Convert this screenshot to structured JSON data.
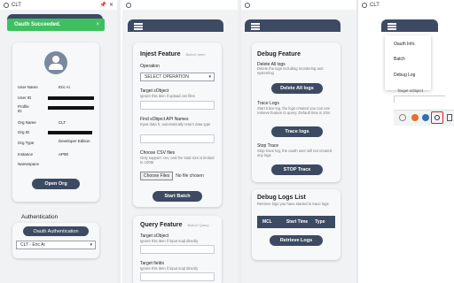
{
  "panel1": {
    "window_title": "CLT",
    "toast": {
      "text": "Oauth Succeeded.",
      "close": "×"
    },
    "profile": {
      "rows": [
        {
          "label": "User Name",
          "value": "Eric Ai"
        },
        {
          "label": "User ID",
          "value": ""
        },
        {
          "label": "Profile ID",
          "value": ""
        },
        {
          "label": "Org Name",
          "value": "CLT"
        },
        {
          "label": "Org ID",
          "value": ""
        },
        {
          "label": "Org Type",
          "value": "Developer Edition"
        },
        {
          "label": "Instance",
          "value": "AP90"
        },
        {
          "label": "Namespace",
          "value": ""
        }
      ],
      "open_org_label": "Open Org"
    },
    "auth": {
      "title": "Authentication",
      "button": "Oauth Authentication",
      "select_value": "CLT - Eric Ai"
    }
  },
  "panel2": {
    "inject": {
      "title": "Injest Feature",
      "badge": "Bulkv2 open",
      "operation_label": "Operation",
      "operation_value": "SELECT OPERATION",
      "target_label": "Target sObject",
      "target_hint": "Ignore this item if upload csv files",
      "fields_label": "Find sObject API Names",
      "fields_hint": "Input data fr, automatically return data type",
      "csv_label": "Choose CSV files",
      "csv_hint": "Only support .csv, and the total size is limited to 100M",
      "choose_btn": "Choose Files",
      "no_file": "No file chosen",
      "start_btn": "Start Batch"
    },
    "query": {
      "title": "Query Feature",
      "badge": "Bulkv2 Query",
      "target_label": "Target sObject",
      "target_hint": "Ignore this item if input soql directly",
      "fields_label": "Target fields",
      "fields_hint": "Ignore this item if input soql directly"
    }
  },
  "panel3": {
    "debug": {
      "title": "Debug Feature",
      "delete_label": "Delete All logs",
      "delete_hint": "Delete the logs including monitoring and systemlog",
      "delete_btn": "Delete All logs",
      "trace_label": "Trace Logs",
      "trace_hint": "Start trace log, the logs created you can use retrieve feature to query. Default time is 10m",
      "trace_btn": "Trace logs",
      "stop_label": "Stop Trace",
      "stop_hint": "Stop trace log, the oauth user will not created any logs",
      "stop_btn": "STOP Trace"
    },
    "list": {
      "title": "Debug Logs List",
      "hint": "Retrieve logs you have started to trace logs",
      "columns": [
        "MCL",
        "Start Time",
        "Type"
      ],
      "retrieve_btn": "Retrieve Logs"
    }
  },
  "panel4": {
    "window_title": "CLT",
    "menu": [
      "Oauth Info.",
      "Batch",
      "Debug Log"
    ],
    "behind_text": "Target sObject"
  }
}
